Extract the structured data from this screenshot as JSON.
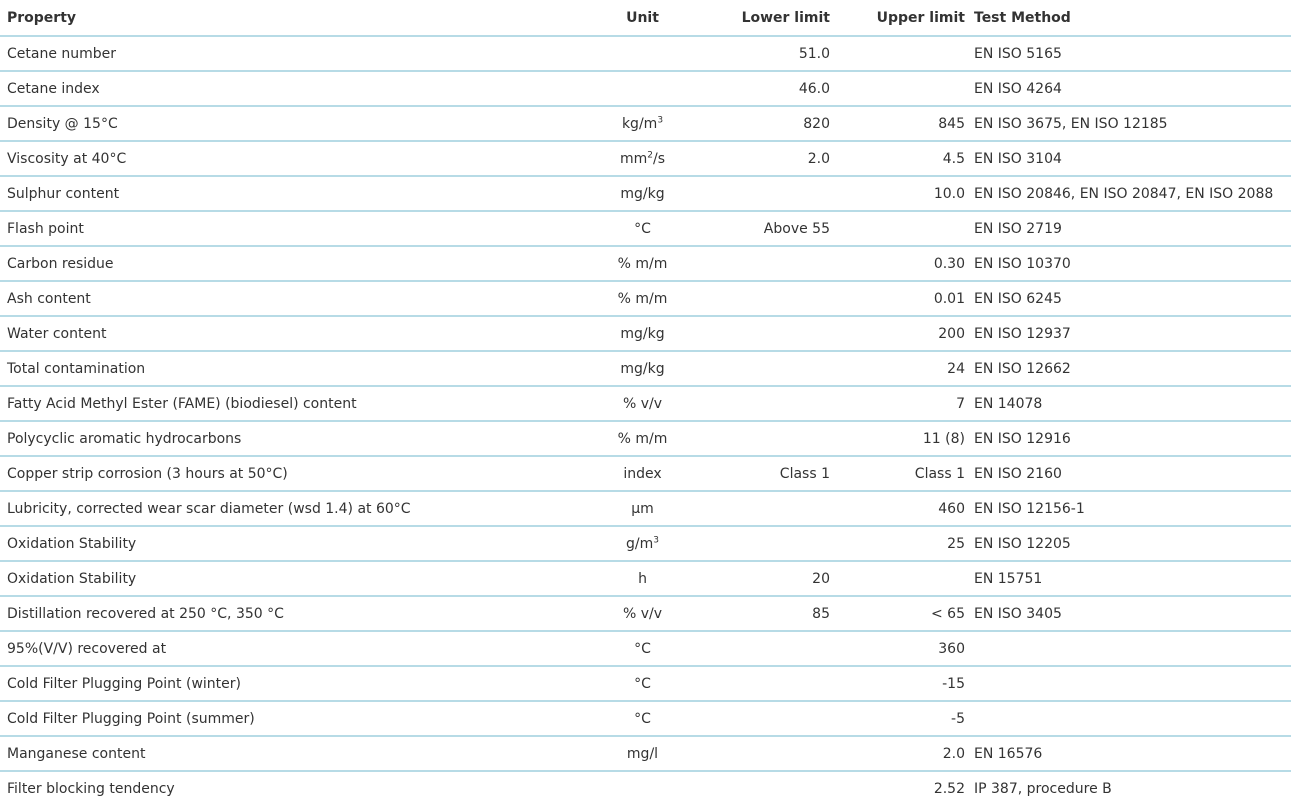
{
  "table": {
    "headers": {
      "property": "Property",
      "unit": "Unit",
      "lower": "Lower limit",
      "upper": "Upper limit",
      "test": "Test Method"
    },
    "rows": [
      {
        "property": "Cetane number",
        "unit": "",
        "lower": "51.0",
        "upper": "",
        "test": "EN ISO 5165"
      },
      {
        "property": "Cetane index",
        "unit": "",
        "lower": "46.0",
        "upper": "",
        "test": "EN ISO 4264"
      },
      {
        "property": "Density @ 15°C",
        "unit": "kg/m",
        "unit_sup": "3",
        "unit_tail": "",
        "lower": "820",
        "upper": "845",
        "test": "EN ISO 3675, EN ISO 12185"
      },
      {
        "property": "Viscosity at 40°C",
        "unit": "mm",
        "unit_sup": "2",
        "unit_tail": "/s",
        "lower": "2.0",
        "upper": "4.5",
        "test": "EN ISO 3104"
      },
      {
        "property": "Sulphur content",
        "unit": "mg/kg",
        "lower": "",
        "upper": "10.0",
        "test": "EN ISO 20846, EN ISO 20847, EN ISO 2088"
      },
      {
        "property": "Flash point",
        "unit": "°C",
        "lower": "Above 55",
        "upper": "",
        "test": "EN ISO 2719"
      },
      {
        "property": "Carbon residue",
        "unit": "% m/m",
        "lower": "",
        "upper": "0.30",
        "test": "EN ISO 10370"
      },
      {
        "property": "Ash content",
        "unit": "% m/m",
        "lower": "",
        "upper": "0.01",
        "test": "EN ISO 6245"
      },
      {
        "property": "Water content",
        "unit": "mg/kg",
        "lower": "",
        "upper": "200",
        "test": "EN ISO 12937"
      },
      {
        "property": "Total contamination",
        "unit": "mg/kg",
        "lower": "",
        "upper": "24",
        "test": "EN ISO 12662"
      },
      {
        "property": "Fatty Acid Methyl Ester (FAME) (biodiesel) content",
        "unit": "% v/v",
        "lower": "",
        "upper": "7",
        "test": "EN 14078"
      },
      {
        "property": "Polycyclic aromatic hydrocarbons",
        "unit": "% m/m",
        "lower": "",
        "upper": "11 (8)",
        "test": "EN ISO 12916"
      },
      {
        "property": "Copper strip corrosion (3 hours at 50°C)",
        "unit": "index",
        "lower": "Class 1",
        "upper": "Class 1",
        "test": "EN ISO 2160"
      },
      {
        "property": "Lubricity, corrected wear scar diameter (wsd 1.4) at 60°C",
        "unit": "µm",
        "lower": "",
        "upper": "460",
        "test": "EN ISO 12156-1"
      },
      {
        "property": "Oxidation Stability",
        "unit": "g/m",
        "unit_sup": "3",
        "unit_tail": "",
        "lower": "",
        "upper": "25",
        "test": "EN ISO 12205"
      },
      {
        "property": "Oxidation Stability",
        "unit": "h",
        "lower": "20",
        "upper": "",
        "test": "EN 15751"
      },
      {
        "property": "Distillation recovered at 250 °C, 350 °C",
        "unit": "% v/v",
        "lower": "85",
        "upper": "< 65",
        "test": "EN ISO 3405"
      },
      {
        "property": "95%(V/V) recovered at",
        "unit": "°C",
        "lower": "",
        "upper": "360",
        "test": ""
      },
      {
        "property": "Cold Filter Plugging Point (winter)",
        "unit": "°C",
        "lower": "",
        "upper": "-15",
        "test": ""
      },
      {
        "property": "Cold Filter Plugging Point (summer)",
        "unit": "°C",
        "lower": "",
        "upper": "-5",
        "test": ""
      },
      {
        "property": "Manganese content",
        "unit": "mg/l",
        "lower": "",
        "upper": "2.0",
        "test": "EN 16576"
      },
      {
        "property": "Filter blocking tendency",
        "unit": "",
        "lower": "",
        "upper": "2.52",
        "test": "IP 387, procedure B"
      }
    ]
  }
}
